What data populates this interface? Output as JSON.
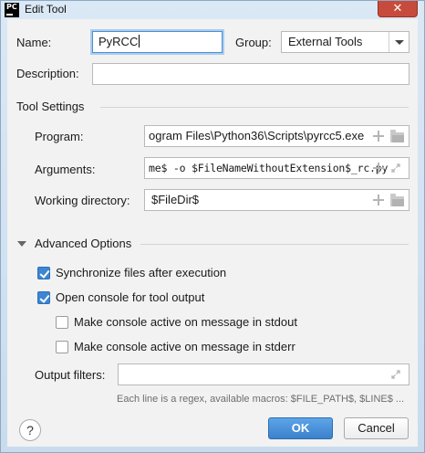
{
  "window": {
    "title": "Edit Tool",
    "app_icon_text": "PC",
    "close_glyph": "✕"
  },
  "form": {
    "name_label": "Name:",
    "name_value": "PyRCC",
    "group_label": "Group:",
    "group_value": "External Tools",
    "description_label": "Description:",
    "description_value": ""
  },
  "tool_settings": {
    "section_title": "Tool Settings",
    "program_label": "Program:",
    "program_value": "ogram Files\\Python36\\Scripts\\pyrcc5.exe",
    "arguments_label": "Arguments:",
    "arguments_value": "me$ -o $FileNameWithoutExtension$_rc.py",
    "working_dir_label": "Working directory:",
    "working_dir_value": "$FileDir$"
  },
  "advanced": {
    "section_title": "Advanced Options",
    "options": [
      {
        "label": "Synchronize files after execution",
        "checked": true
      },
      {
        "label": "Open console for tool output",
        "checked": true
      },
      {
        "label": "Make console active on message in stdout",
        "checked": false
      },
      {
        "label": "Make console active on message in stderr",
        "checked": false
      }
    ],
    "output_filters_label": "Output filters:",
    "output_filters_value": "",
    "hint": "Each line is a regex, available macros: $FILE_PATH$, $LINE$ ..."
  },
  "buttons": {
    "help": "?",
    "ok": "OK",
    "cancel": "Cancel"
  },
  "colors": {
    "accent": "#3b82cc",
    "focus_ring": "#a9cdf0",
    "close": "#c74b3c"
  }
}
